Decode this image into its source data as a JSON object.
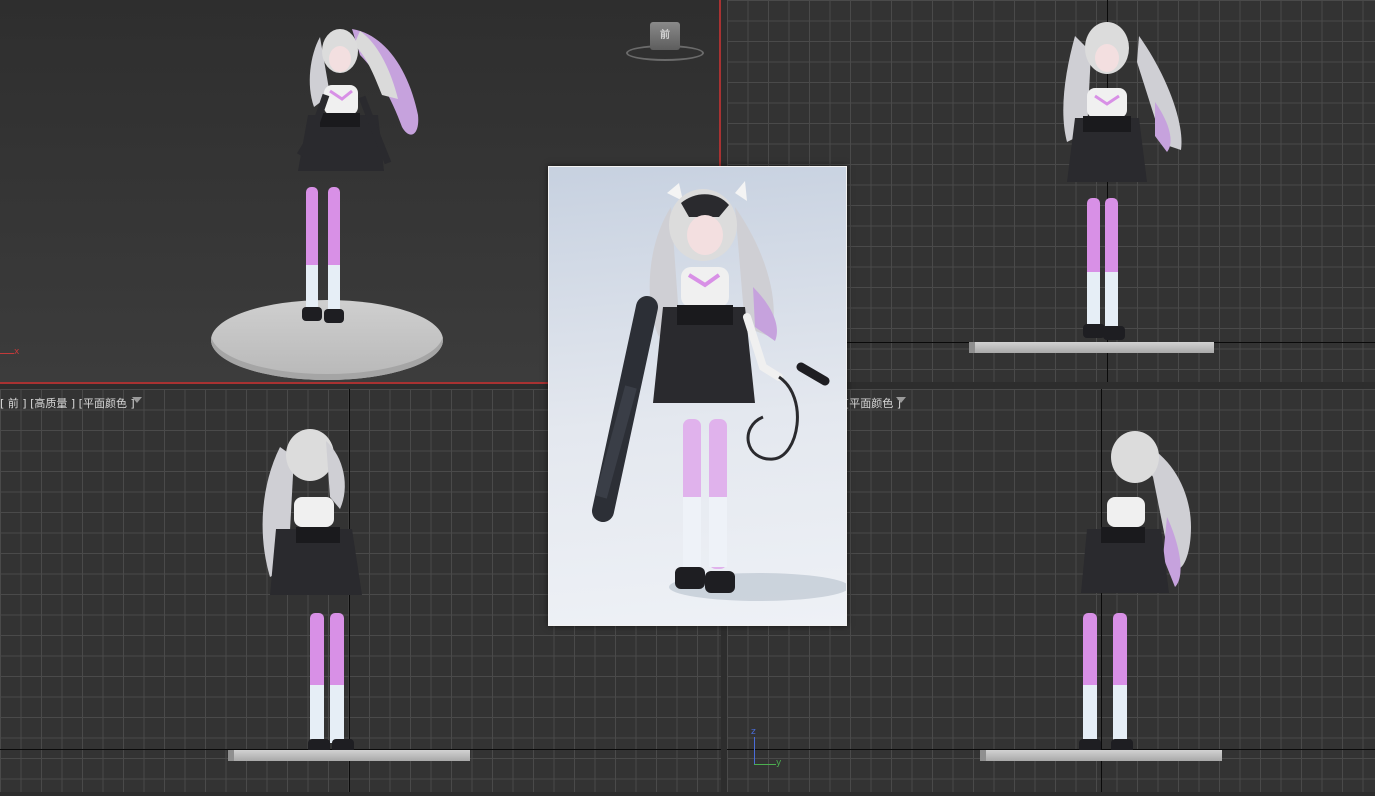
{
  "viewports": {
    "perspective": {
      "label": "",
      "nav_cube_label": "前",
      "axis_label_x": "x"
    },
    "top_right": {
      "label": ""
    },
    "bottom_left": {
      "label": "[ 前 ] [高质量 ] [平面颜色 ]"
    },
    "bottom_right": {
      "label": "[平面颜色 ]",
      "axis_label_y": "y",
      "axis_label_z": "z"
    }
  },
  "reference_image": {
    "icon": "character-reference-image"
  },
  "colors": {
    "active_border": "#a83232",
    "viewport_bg": "#333333",
    "grid_line": "#4a4a4a",
    "axis_line": "#0a0a0a",
    "ground_plane": "#c3c3c3",
    "stocking_pink": "#d890e6",
    "skirt_black": "#2a2a2e",
    "hair_silver": "#cfcfd4",
    "hair_lavender": "#c6a2dd"
  }
}
